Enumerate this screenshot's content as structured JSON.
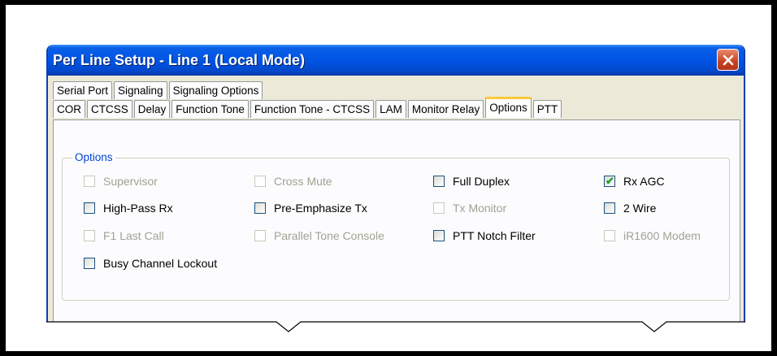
{
  "window": {
    "title": "Per Line Setup - Line 1 (Local Mode)",
    "close_label": "✕"
  },
  "tabs_row1": [
    "Serial Port",
    "Signaling",
    "Signaling Options"
  ],
  "tabs_row2": [
    "COR",
    "CTCSS",
    "Delay",
    "Function Tone",
    "Function Tone - CTCSS",
    "LAM",
    "Monitor Relay",
    "Options",
    "PTT"
  ],
  "active_tab": "Options",
  "group": {
    "label": "Options",
    "columns": [
      [
        {
          "label": "Supervisor",
          "checked": false,
          "enabled": false
        },
        {
          "label": "High-Pass Rx",
          "checked": false,
          "enabled": true
        },
        {
          "label": "F1 Last Call",
          "checked": false,
          "enabled": false
        },
        {
          "label": "Busy Channel Lockout",
          "checked": false,
          "enabled": true
        }
      ],
      [
        {
          "label": "Cross Mute",
          "checked": false,
          "enabled": false
        },
        {
          "label": "Pre-Emphasize Tx",
          "checked": false,
          "enabled": true
        },
        {
          "label": "Parallel Tone Console",
          "checked": false,
          "enabled": false
        }
      ],
      [
        {
          "label": "Full Duplex",
          "checked": false,
          "enabled": true
        },
        {
          "label": "Tx Monitor",
          "checked": false,
          "enabled": false
        },
        {
          "label": "PTT Notch Filter",
          "checked": false,
          "enabled": true
        }
      ],
      [
        {
          "label": "Rx AGC",
          "checked": true,
          "enabled": true
        },
        {
          "label": "2 Wire",
          "checked": false,
          "enabled": true
        },
        {
          "label": "iR1600 Modem",
          "checked": false,
          "enabled": false
        }
      ]
    ]
  },
  "check_glyph": "✔"
}
